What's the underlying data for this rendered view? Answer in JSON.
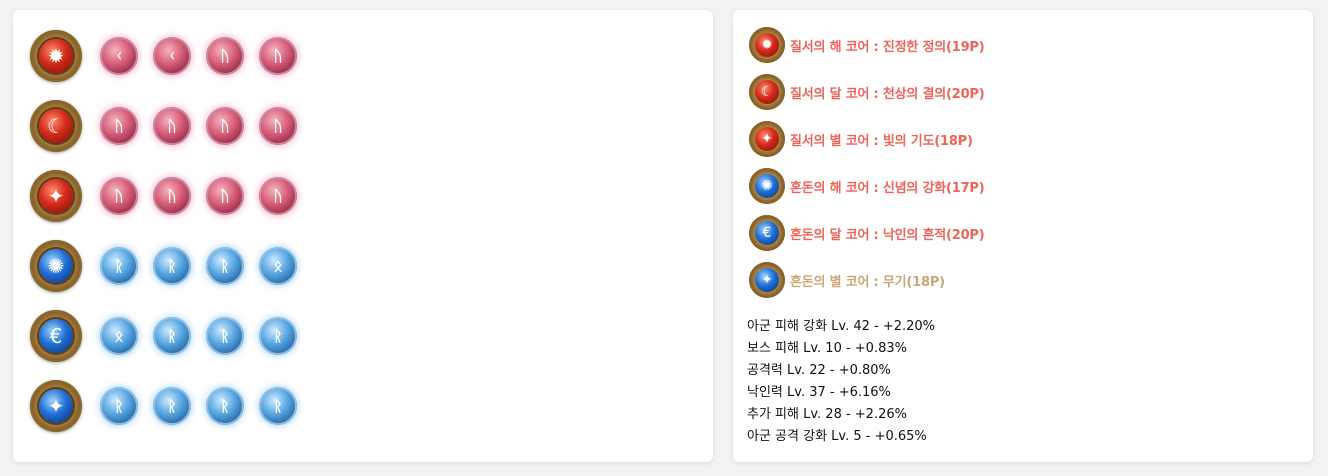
{
  "colors": {
    "core_label_ancient": "#f0645a",
    "core_label_relic": "#c9a77a",
    "effect_text": "#111111"
  },
  "gem_grid": [
    {
      "core": {
        "color": "red",
        "icon": "sun-icon",
        "glyph": "✹"
      },
      "gems": [
        {
          "color": "red",
          "icon": "rune-icon",
          "glyph": "ᚲ"
        },
        {
          "color": "red",
          "icon": "rune-icon",
          "glyph": "ᚲ"
        },
        {
          "color": "red",
          "icon": "rune-icon",
          "glyph": "ᚢ"
        },
        {
          "color": "red",
          "icon": "rune-icon",
          "glyph": "ᚢ"
        }
      ]
    },
    {
      "core": {
        "color": "red",
        "icon": "moon-icon",
        "glyph": "☾"
      },
      "gems": [
        {
          "color": "red",
          "icon": "rune-icon",
          "glyph": "ᚢ"
        },
        {
          "color": "red",
          "icon": "rune-icon",
          "glyph": "ᚢ"
        },
        {
          "color": "red",
          "icon": "rune-icon",
          "glyph": "ᚢ"
        },
        {
          "color": "red",
          "icon": "rune-icon",
          "glyph": "ᚢ"
        }
      ]
    },
    {
      "core": {
        "color": "red",
        "icon": "star-icon",
        "glyph": "✦"
      },
      "gems": [
        {
          "color": "red",
          "icon": "rune-icon",
          "glyph": "ᚢ"
        },
        {
          "color": "red",
          "icon": "rune-icon",
          "glyph": "ᚢ"
        },
        {
          "color": "red",
          "icon": "rune-icon",
          "glyph": "ᚢ"
        },
        {
          "color": "red",
          "icon": "rune-icon",
          "glyph": "ᚢ"
        }
      ]
    },
    {
      "core": {
        "color": "blue",
        "icon": "sun-icon",
        "glyph": "✺"
      },
      "gems": [
        {
          "color": "blue",
          "icon": "rune-icon",
          "glyph": "ᚱ"
        },
        {
          "color": "blue",
          "icon": "rune-icon",
          "glyph": "ᚱ"
        },
        {
          "color": "blue",
          "icon": "rune-icon",
          "glyph": "ᚱ"
        },
        {
          "color": "blue",
          "icon": "rune-icon",
          "glyph": "ᛟ"
        }
      ]
    },
    {
      "core": {
        "color": "blue",
        "icon": "moon-icon",
        "glyph": "€"
      },
      "gems": [
        {
          "color": "blue",
          "icon": "rune-icon",
          "glyph": "ᛟ"
        },
        {
          "color": "blue",
          "icon": "rune-icon",
          "glyph": "ᚱ"
        },
        {
          "color": "blue",
          "icon": "rune-icon",
          "glyph": "ᚱ"
        },
        {
          "color": "blue",
          "icon": "rune-icon",
          "glyph": "ᚱ"
        }
      ]
    },
    {
      "core": {
        "color": "blue",
        "icon": "star-icon",
        "glyph": "✦"
      },
      "gems": [
        {
          "color": "blue",
          "icon": "rune-icon",
          "glyph": "ᚱ"
        },
        {
          "color": "blue",
          "icon": "rune-icon",
          "glyph": "ᚱ"
        },
        {
          "color": "blue",
          "icon": "rune-icon",
          "glyph": "ᚱ"
        },
        {
          "color": "blue",
          "icon": "rune-icon",
          "glyph": "ᚱ"
        }
      ]
    }
  ],
  "cores": [
    {
      "label": "질서의 해 코어 : 진정한 정의(19P)",
      "color": "red",
      "icon": "sun-icon",
      "glyph": "✹",
      "grade": "ancient"
    },
    {
      "label": "질서의 달 코어 : 천상의 결의(20P)",
      "color": "red",
      "icon": "moon-icon",
      "glyph": "☾",
      "grade": "ancient"
    },
    {
      "label": "질서의 별 코어 : 빛의 기도(18P)",
      "color": "red",
      "icon": "star-icon",
      "glyph": "✦",
      "grade": "ancient"
    },
    {
      "label": "혼돈의 해 코어 : 신념의 강화(17P)",
      "color": "blue",
      "icon": "sun-icon",
      "glyph": "✺",
      "grade": "ancient"
    },
    {
      "label": "혼돈의 달 코어 : 낙인의 흔적(20P)",
      "color": "blue",
      "icon": "moon-icon",
      "glyph": "€",
      "grade": "ancient"
    },
    {
      "label": "혼돈의 별 코어 : 무기(18P)",
      "color": "blue",
      "icon": "star-icon",
      "glyph": "✦",
      "grade": "relic"
    }
  ],
  "effects": [
    "아군 피해 강화 Lv. 42 - +2.20%",
    "보스 피해 Lv. 10 - +0.83%",
    "공격력 Lv. 22 - +0.80%",
    "낙인력 Lv. 37 - +6.16%",
    "추가 피해 Lv. 28 - +2.26%",
    "아군 공격 강화 Lv. 5 - +0.65%"
  ]
}
